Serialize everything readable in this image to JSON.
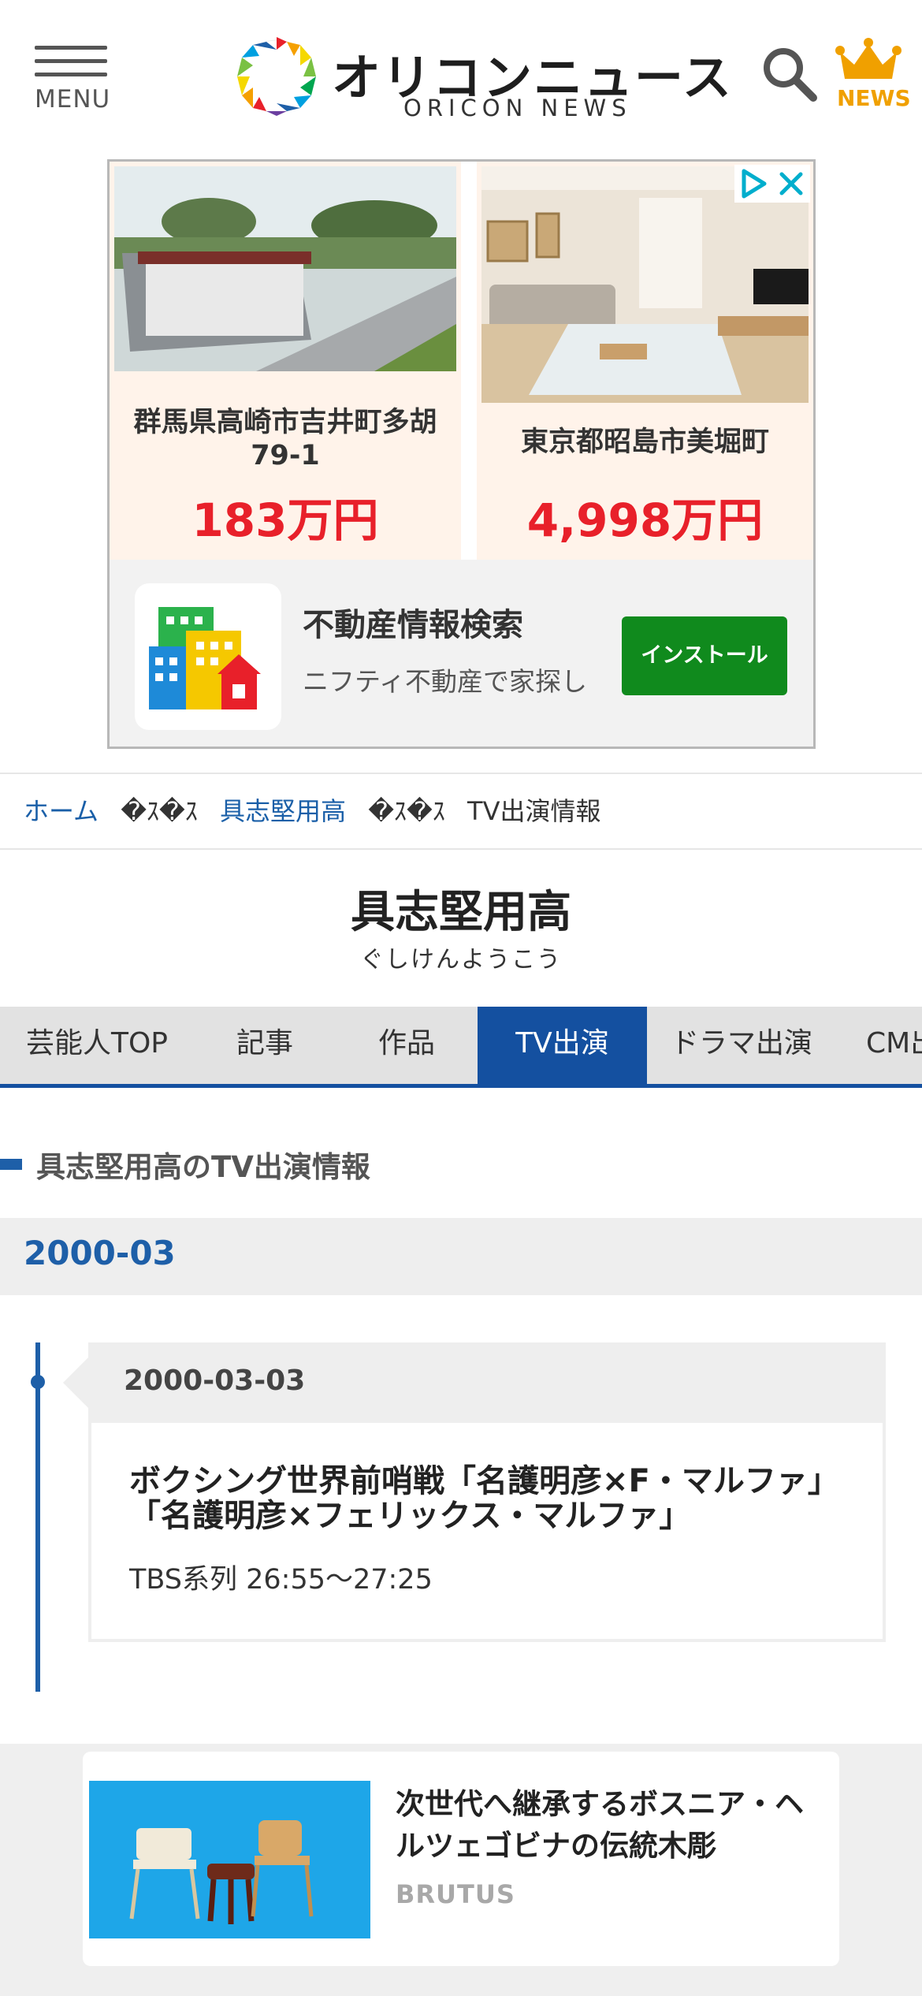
{
  "header": {
    "menu_label": "MENU",
    "logo_text_jp": "オリコンニュース",
    "logo_text_en": "ORICON NEWS",
    "news_label": "NEWS",
    "icons": [
      "menu-icon",
      "search-icon",
      "crown-icon"
    ],
    "crown_color": "#f0a000"
  },
  "ad": {
    "listings": [
      {
        "location": "群馬県高崎市吉井町多胡79-1",
        "price": "183万円"
      },
      {
        "location": "東京都昭島市美堀町",
        "price": "4,998万円"
      }
    ],
    "app_title": "不動産情報検索",
    "app_desc": "ニフティ不動産で家探し",
    "install_label": "インストール",
    "price_color": "#e8202a",
    "install_color": "#108a1d"
  },
  "breadcrumb": {
    "home": "ホーム",
    "separator": "�ｽ�ｽ",
    "person": "具志堅用高",
    "current": "TV出演情報"
  },
  "person": {
    "name": "具志堅用高",
    "reading": "ぐしけんようこう"
  },
  "tabs": [
    "芸能人TOP",
    "記事",
    "作品",
    "TV出演",
    "ドラマ出演",
    "CM出演"
  ],
  "active_tab": "TV出演",
  "section_title": "具志堅用高のTV出演情報",
  "month": "2000-03",
  "appearances": [
    {
      "date": "2000-03-03",
      "title": "ボクシング世界前哨戦「名護明彦×F・マルファ」「名護明彦×フェリックス・マルファ」",
      "channel": "TBS系列 26:55〜27:25"
    }
  ],
  "recommendation": {
    "title": "次世代へ継承するボスニア・ヘルツェゴビナの伝統木彫",
    "source": "BRUTUS"
  },
  "accent_color": "#1450a0"
}
